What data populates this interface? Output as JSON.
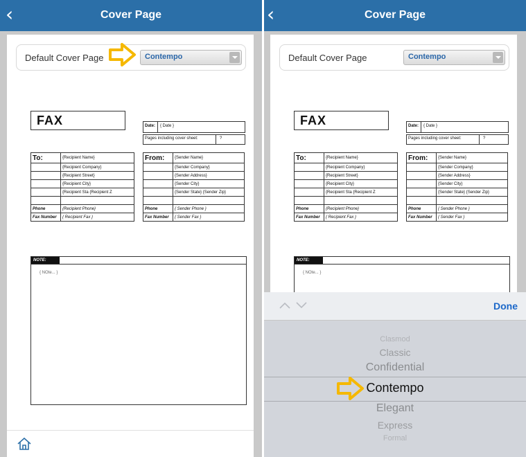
{
  "left": {
    "nav": {
      "title": "Cover Page"
    },
    "default_label": "Default Cover Page",
    "dropdown_value": "Contempo"
  },
  "right": {
    "nav": {
      "title": "Cover Page"
    },
    "default_label": "Default Cover Page",
    "dropdown_value": "Contempo"
  },
  "fax": {
    "title": "FAX",
    "date_label": "Date:",
    "date_value": "{ Date }",
    "pages_label": "Pages including cover sheet:",
    "pages_value": "?",
    "to_label": "To:",
    "from_label": "From:",
    "recipient": [
      "{Recipient Name}",
      "{Recipient Company}",
      "{Recipient Street}",
      "{Recipient City}",
      "{Recipient Sta {Recipient Z"
    ],
    "recipient_right": [
      "{Recipient Name}",
      "{Recipient Company}",
      "{Recipient Street}",
      "{Recipient City}",
      "{Recipient Sta {Recipient Z"
    ],
    "sender": [
      "{Sender Name}",
      "{Sender Company}",
      "{Sender Address}",
      "{Sender City}",
      "{Sender State} {Sender Zip}"
    ],
    "sender_right": [
      "{Sender Name}",
      "{Sender Company}",
      "{Sender Address}",
      "{Sender City}",
      "{Sender State} {Sender Zip}"
    ],
    "phone_label": "Phone",
    "fax_number_label": "Fax Number",
    "recipient_phone": "{Recipient Phone}",
    "recipient_fax": "{ Recipient Fax }",
    "sender_phone": "{ Sender Phone }",
    "sender_fax": "{ Sender Fax }",
    "note_label": "NOTE:",
    "note_text": "{ NOte... }"
  },
  "picker": {
    "done_label": "Done",
    "items": [
      "Clasmod",
      "Classic",
      "Confidential",
      "Contempo",
      "Elegant",
      "Express",
      "Formal"
    ],
    "selected": "Contempo"
  },
  "colors": {
    "nav_bg": "#2b6fa8",
    "accent": "#1b67c9",
    "arrow": "#f5b800"
  }
}
